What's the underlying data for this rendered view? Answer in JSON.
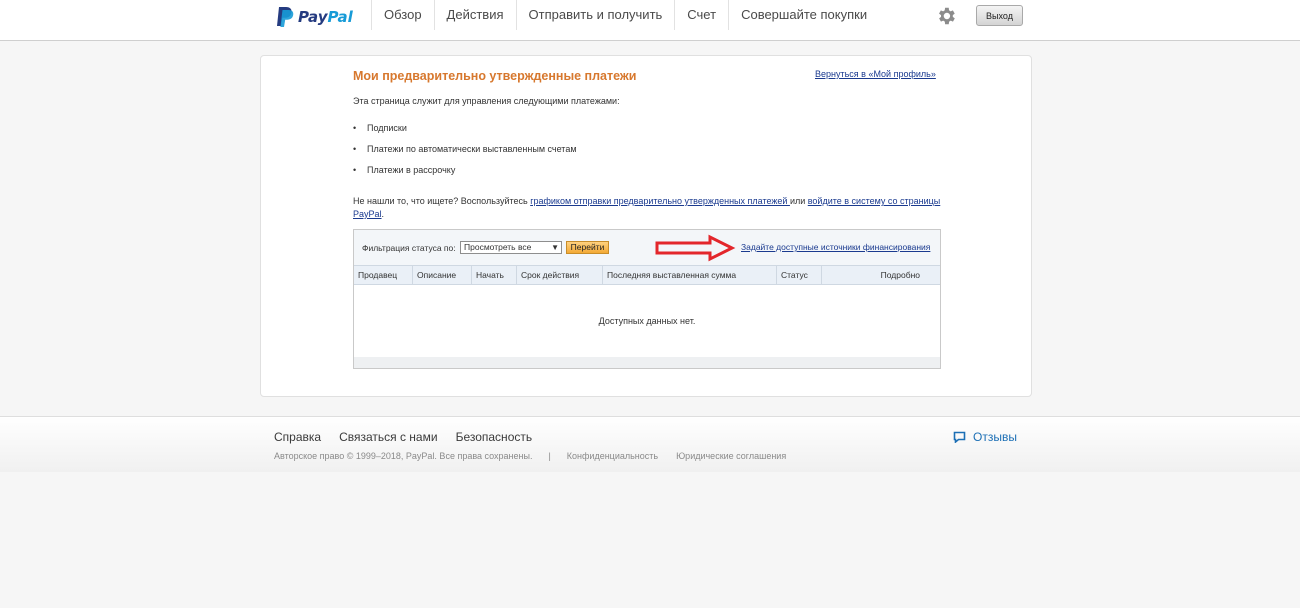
{
  "header": {
    "logo_text_a": "Pay",
    "logo_text_b": "Pal",
    "nav": [
      "Обзор",
      "Действия",
      "Отправить и получить",
      "Счет",
      "Совершайте покупки"
    ],
    "logout_label": "Выход",
    "settings_icon": "gear-icon"
  },
  "main": {
    "title": "Мои предварительно утвержденные платежи",
    "back_link": "Вернуться в «Мой профиль»",
    "intro": "Эта страница служит для управления следующими платежами:",
    "bullets": [
      "Подписки",
      "Платежи по автоматически выставленным счетам",
      "Платежи в рассрочку"
    ],
    "help_text_before": "Не нашли то, что ищете? Воспользуйтесь ",
    "help_link1": "графиком отправки предварительно утвержденных платежей ",
    "help_text_mid": "или ",
    "help_link2": "войдите в систему со страницы PayPal",
    "help_text_end": "."
  },
  "table": {
    "filter_label": "Фильтрация статуса по:",
    "filter_value": "Просмотреть все",
    "go_label": "Перейти",
    "funding_link": "Задайте доступные источники финансирования",
    "columns": [
      "Продавец",
      "Описание",
      "Начать",
      "Срок действия",
      "Последняя выставленная сумма",
      "Статус",
      "Подробно"
    ],
    "empty_message": "Доступных данных нет."
  },
  "footer": {
    "links": [
      "Справка",
      "Связаться с нами",
      "Безопасность"
    ],
    "copyright": "Авторское право © 1999–2018, PayPal. Все права сохранены.",
    "separator": "|",
    "privacy": "Конфиденциальность",
    "legal": "Юридические соглашения",
    "feedback": "Отзывы"
  },
  "colors": {
    "title_orange": "#d7782e",
    "link_blue": "#1a3a8f",
    "annotation_red": "#e3262b",
    "feedback_blue": "#1c6fb5"
  }
}
